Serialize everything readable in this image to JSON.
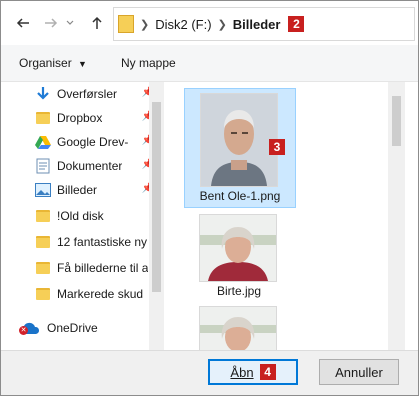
{
  "address": {
    "segments": [
      "Disk2 (F:)",
      "Billeder"
    ],
    "badge": "2"
  },
  "toolbar": {
    "organize_label": "Organiser",
    "new_folder_label": "Ny mappe"
  },
  "sidebar": {
    "items": [
      {
        "label": "Overførsler",
        "icon": "download-arrow-icon",
        "pinned": true
      },
      {
        "label": "Dropbox",
        "icon": "folder-icon",
        "pinned": true
      },
      {
        "label": "Google Drev-",
        "icon": "google-drive-icon",
        "pinned": true
      },
      {
        "label": "Dokumenter",
        "icon": "documents-icon",
        "pinned": true
      },
      {
        "label": "Billeder",
        "icon": "pictures-icon",
        "pinned": true
      },
      {
        "label": "!Old disk",
        "icon": "folder-icon",
        "pinned": false
      },
      {
        "label": "12 fantastiske ny",
        "icon": "folder-icon",
        "pinned": false
      },
      {
        "label": "Få billederne til a",
        "icon": "folder-icon",
        "pinned": false
      },
      {
        "label": "Markerede skud",
        "icon": "folder-icon",
        "pinned": false
      }
    ],
    "onedrive_label": "OneDrive"
  },
  "files": [
    {
      "name": "Bent Ole-1.png",
      "selected": true,
      "badge": "3"
    },
    {
      "name": "Birte.jpg",
      "selected": false
    },
    {
      "name": "",
      "selected": false
    }
  ],
  "footer": {
    "open_label": "Åbn",
    "open_badge": "4",
    "cancel_label": "Annuller"
  },
  "colors": {
    "accent": "#0078d7",
    "badge": "#c8201f",
    "selection": "#cce8ff"
  }
}
